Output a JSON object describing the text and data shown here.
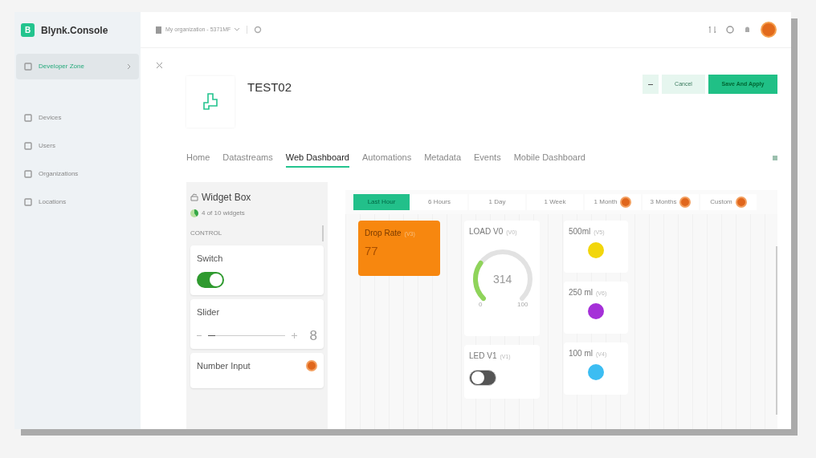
{
  "app": {
    "logo_letter": "B",
    "name": "Blynk.Console"
  },
  "org_selector": "My organization - 5371MF",
  "sidebar": {
    "items": [
      {
        "label": "Developer Zone",
        "selected": true
      },
      {
        "label": "Devices",
        "selected": false
      },
      {
        "label": "Users",
        "selected": false
      },
      {
        "label": "Organizations",
        "selected": false
      },
      {
        "label": "Locations",
        "selected": false
      }
    ]
  },
  "template": {
    "title": "TEST02"
  },
  "actions": {
    "cancel": "Cancel",
    "save": "Save And Apply"
  },
  "tabs": [
    {
      "label": "Home",
      "selected": false
    },
    {
      "label": "Datastreams",
      "selected": false
    },
    {
      "label": "Web Dashboard",
      "selected": true
    },
    {
      "label": "Automations",
      "selected": false
    },
    {
      "label": "Metadata",
      "selected": false
    },
    {
      "label": "Events",
      "selected": false
    },
    {
      "label": "Mobile Dashboard",
      "selected": false
    }
  ],
  "widget_box": {
    "title": "Widget Box",
    "usage": "4 of 10 widgets",
    "section": "CONTROL",
    "widgets": [
      {
        "kind": "switch",
        "label": "Switch",
        "on": true,
        "premium": false
      },
      {
        "kind": "slider",
        "label": "Slider",
        "level": 0.1,
        "reading": "8",
        "premium": false
      },
      {
        "kind": "number",
        "label": "Number Input",
        "premium": true
      }
    ]
  },
  "time_ranges": [
    {
      "label": "Last Hour",
      "selected": true,
      "premium": false
    },
    {
      "label": "6 Hours",
      "selected": false,
      "premium": false
    },
    {
      "label": "1 Day",
      "selected": false,
      "premium": false
    },
    {
      "label": "1 Week",
      "selected": false,
      "premium": false
    },
    {
      "label": "1 Month",
      "selected": false,
      "premium": true
    },
    {
      "label": "3 Months",
      "selected": false,
      "premium": true
    },
    {
      "label": "Custom",
      "selected": false,
      "premium": true
    }
  ],
  "dashboard": {
    "columns": [
      [
        {
          "kind": "value",
          "title": "Drop Rate",
          "pin": "(V3)",
          "value": "77"
        }
      ],
      [
        {
          "kind": "gauge",
          "title": "LOAD V0",
          "pin": "(V0)",
          "value": "314",
          "min": "0",
          "max": "100"
        },
        {
          "kind": "switch",
          "title": "LED V1",
          "pin": "(V1)",
          "on": false
        }
      ],
      [
        {
          "kind": "led",
          "title": "500ml",
          "pin": "(V5)",
          "color": "#f2d60c"
        },
        {
          "kind": "led",
          "title": "250 ml",
          "pin": "(V6)",
          "color": "#a530d8"
        },
        {
          "kind": "led",
          "title": "100 ml",
          "pin": "(V4)",
          "color": "#3cbdf2"
        }
      ]
    ]
  }
}
